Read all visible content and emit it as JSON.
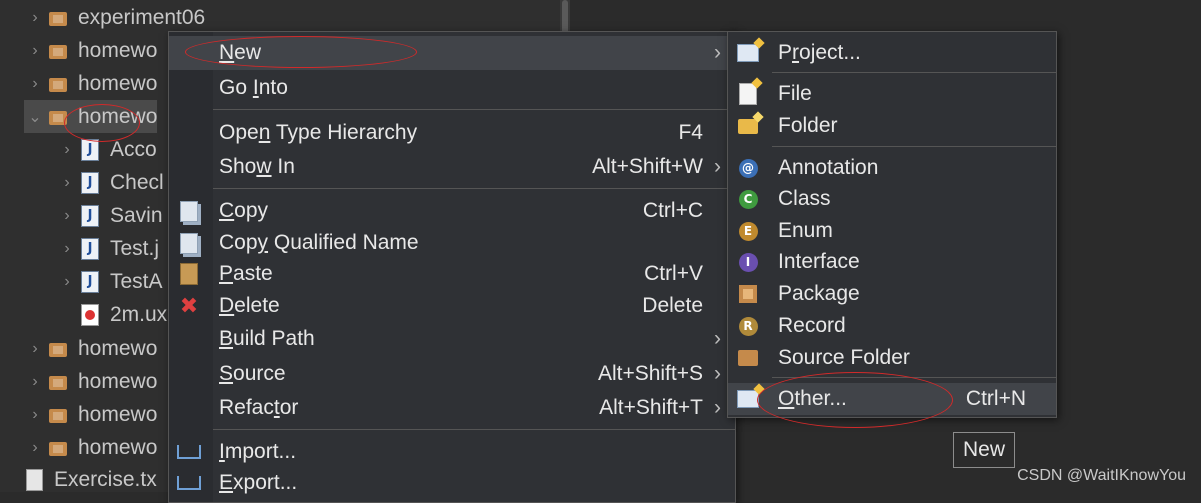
{
  "tree": {
    "items": [
      {
        "chev": "›",
        "icon": "project-icon",
        "label": "experiment06"
      },
      {
        "chev": "›",
        "icon": "project-icon",
        "label": "homewo"
      },
      {
        "chev": "›",
        "icon": "project-icon",
        "label": "homewo"
      },
      {
        "chev": "⌄",
        "icon": "project-icon",
        "label": "homewo",
        "selected": true
      },
      {
        "chev": "›",
        "icon": "java-file-icon",
        "label": "Acco"
      },
      {
        "chev": "›",
        "icon": "java-file-icon",
        "label": "Checl"
      },
      {
        "chev": "›",
        "icon": "java-file-icon",
        "label": "Savin"
      },
      {
        "chev": "›",
        "icon": "java-file-icon",
        "label": "Test.j"
      },
      {
        "chev": "›",
        "icon": "java-file-icon",
        "label": "TestA"
      },
      {
        "chev": "",
        "icon": "uxf-file-icon",
        "label": "2m.ux"
      },
      {
        "chev": "›",
        "icon": "project-icon",
        "label": "homewo"
      },
      {
        "chev": "›",
        "icon": "project-icon",
        "label": "homewo"
      },
      {
        "chev": "›",
        "icon": "project-icon",
        "label": "homewo"
      },
      {
        "chev": "›",
        "icon": "project-icon",
        "label": "homewo"
      },
      {
        "chev": "",
        "icon": "text-file-icon",
        "label": "Exercise.tx"
      }
    ]
  },
  "menu": {
    "new": {
      "pre": "",
      "u": "N",
      "post": "ew",
      "arrow": "›"
    },
    "go_into": {
      "pre": "Go ",
      "u": "I",
      "post": "nto"
    },
    "open_type_hierarchy": {
      "pre": "Ope",
      "u": "n",
      "post": " Type Hierarchy",
      "accel": "F4"
    },
    "show_in": {
      "pre": "Sho",
      "u": "w",
      "post": " In",
      "accel": "Alt+Shift+W",
      "arrow": "›"
    },
    "copy": {
      "pre": "",
      "u": "C",
      "post": "opy",
      "accel": "Ctrl+C"
    },
    "copy_qualified": {
      "pre": "Cop",
      "u": "y",
      "post": " Qualified Name"
    },
    "paste": {
      "pre": "",
      "u": "P",
      "post": "aste",
      "accel": "Ctrl+V"
    },
    "delete": {
      "pre": "",
      "u": "D",
      "post": "elete",
      "accel": "Delete"
    },
    "build_path": {
      "pre": "",
      "u": "B",
      "post": "uild Path",
      "arrow": "›"
    },
    "source": {
      "pre": "",
      "u": "S",
      "post": "ource",
      "accel": "Alt+Shift+S",
      "arrow": "›"
    },
    "refactor": {
      "pre": "Refac",
      "u": "t",
      "post": "or",
      "accel": "Alt+Shift+T",
      "arrow": "›"
    },
    "import": {
      "pre": "",
      "u": "I",
      "post": "mport..."
    },
    "export": {
      "pre": "",
      "u": "E",
      "post": "xport..."
    }
  },
  "submenu": {
    "project": {
      "pre": "P",
      "u": "r",
      "post": "oject..."
    },
    "file": "File",
    "folder": "Folder",
    "annotation": "Annotation",
    "class": "Class",
    "enum": "Enum",
    "interface": "Interface",
    "package": "Package",
    "record": "Record",
    "source_folder": "Source Folder",
    "other": {
      "pre": "",
      "u": "O",
      "post": "ther...",
      "accel": "Ctrl+N"
    }
  },
  "icon_letters": {
    "annotation": "@",
    "class": "C",
    "enum": "E",
    "interface": "I",
    "record": "R",
    "java": "J"
  },
  "colors": {
    "annotation": "#3b6fb6",
    "class": "#3f9b3f",
    "enum": "#c08a2e",
    "interface": "#6a4fb0",
    "record": "#b08a3a",
    "annotation_mark": "#d12a2a"
  },
  "tooltip": "New",
  "watermark": "CSDN @WaitIKnowYou"
}
